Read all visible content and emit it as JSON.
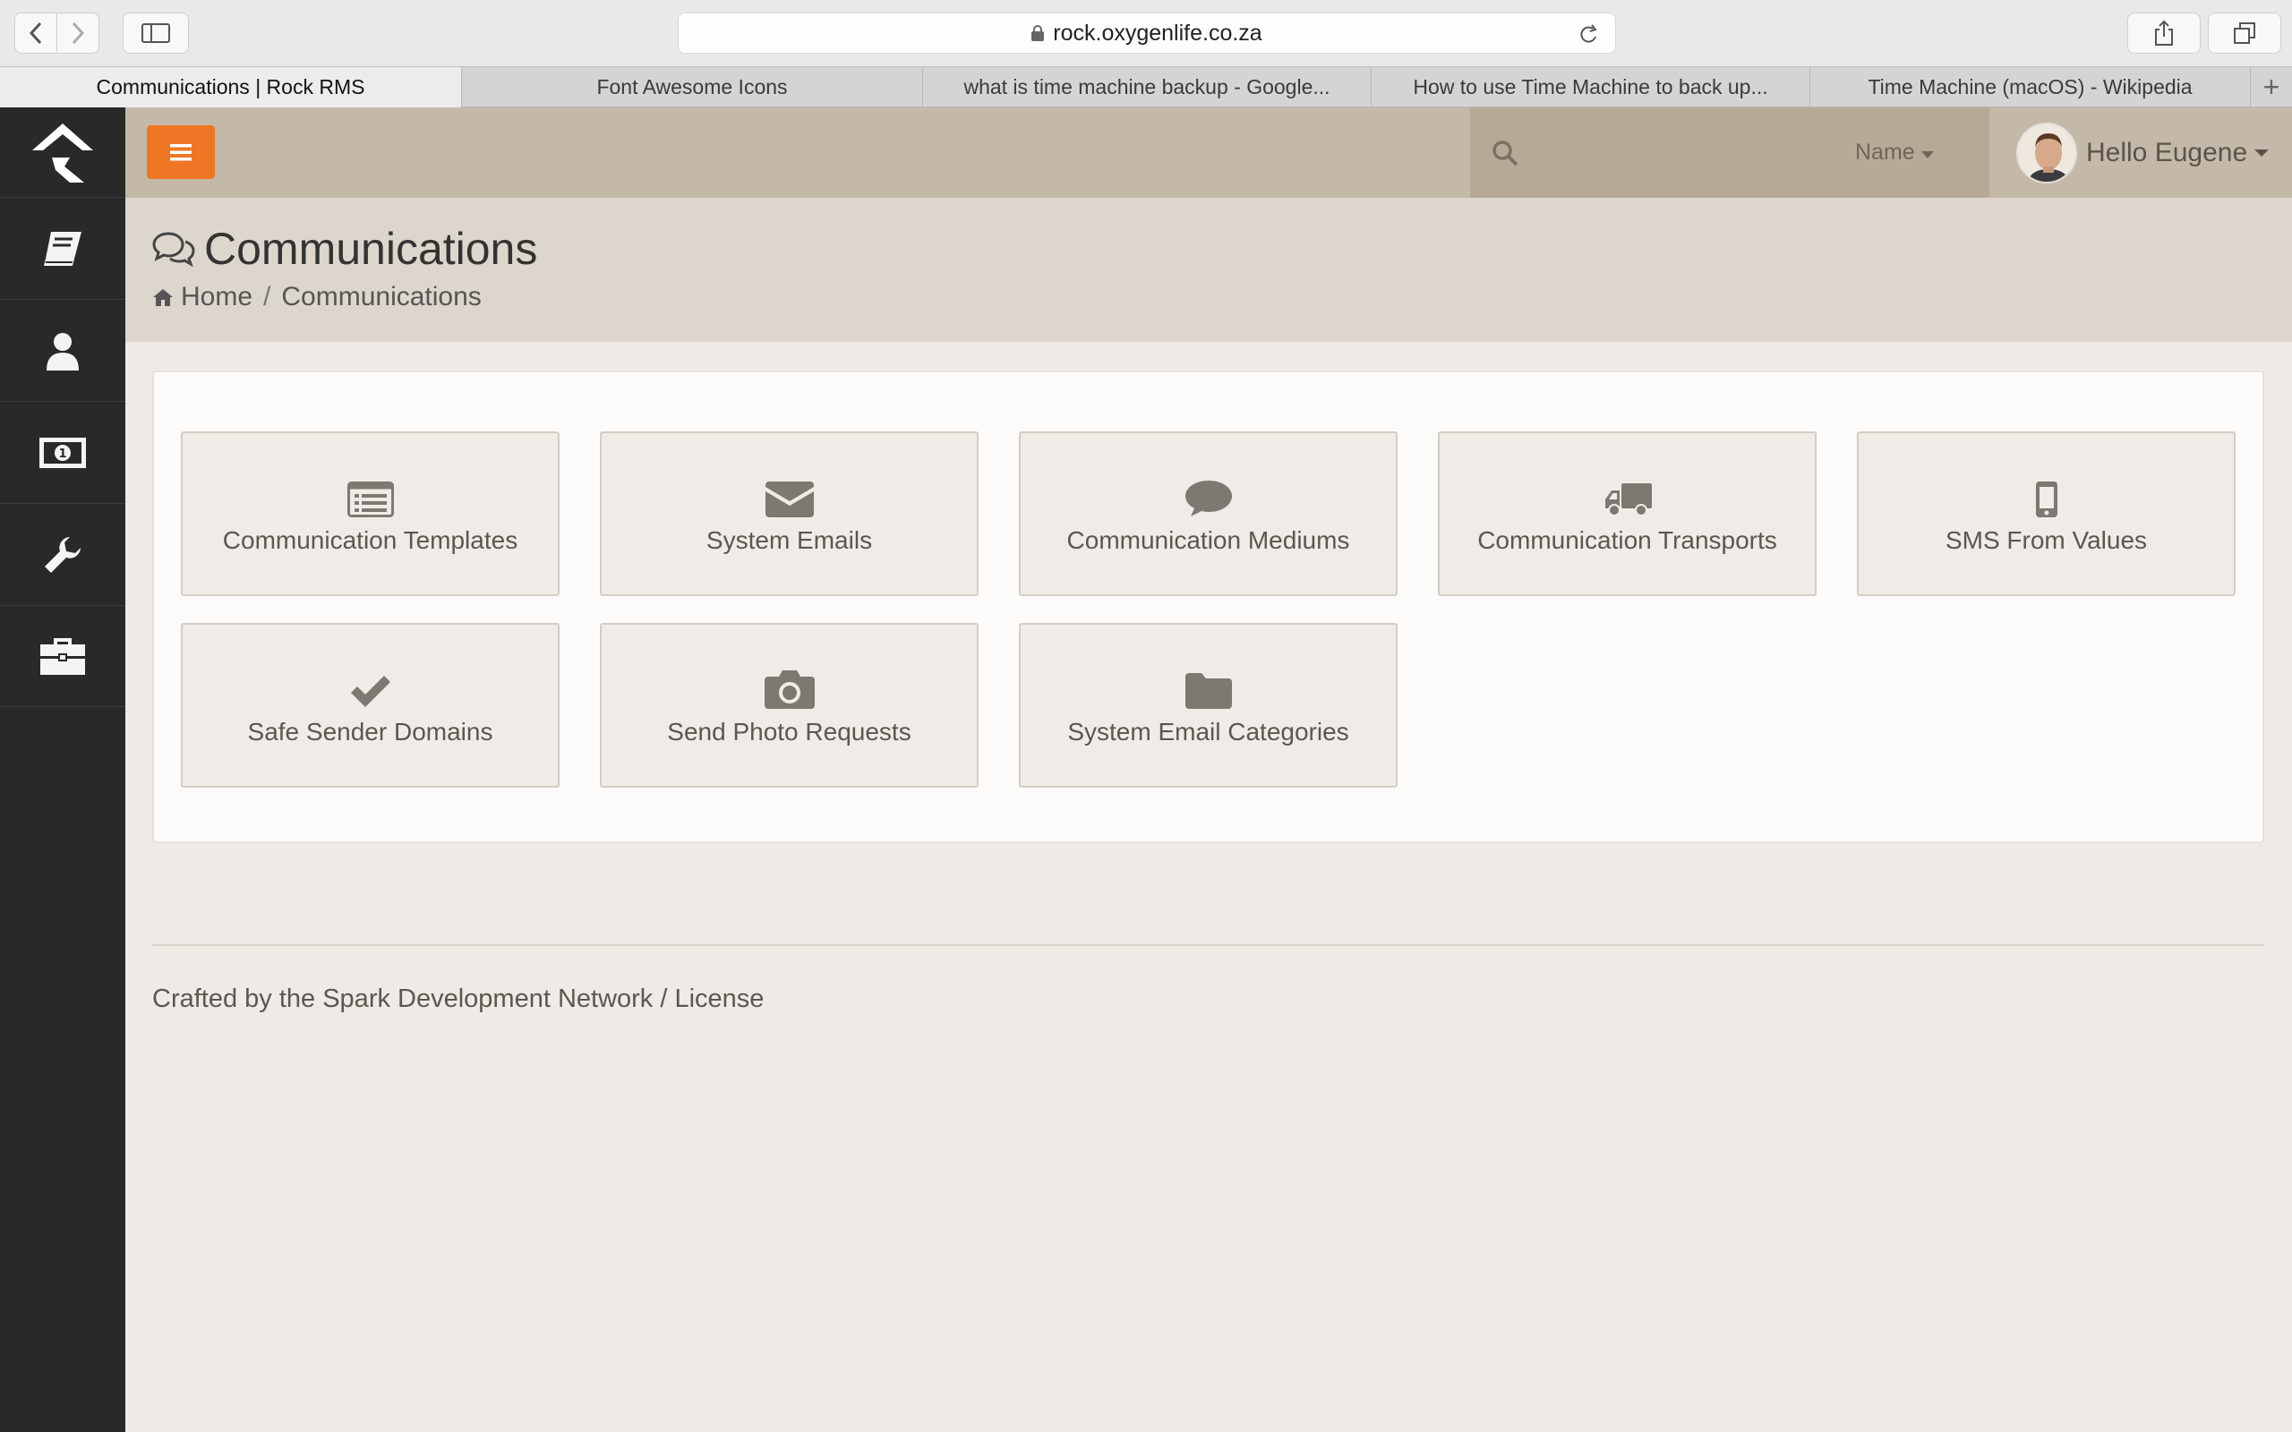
{
  "browser": {
    "url": "rock.oxygenlife.co.za",
    "tabs": [
      {
        "label": "Communications | Rock RMS",
        "active": true
      },
      {
        "label": "Font Awesome Icons",
        "active": false
      },
      {
        "label": "what is time machine backup - Google...",
        "active": false
      },
      {
        "label": "How to use Time Machine to back up...",
        "active": false
      },
      {
        "label": "Time Machine (macOS) - Wikipedia",
        "active": false
      }
    ],
    "new_tab_label": "+"
  },
  "header": {
    "search_placeholder": "",
    "search_filter_label": "Name",
    "user_greeting": "Hello Eugene",
    "accent_color": "#ee7625"
  },
  "sidebar": {
    "items": [
      {
        "icon": "book-icon"
      },
      {
        "icon": "user-icon"
      },
      {
        "icon": "money-icon"
      },
      {
        "icon": "wrench-icon"
      },
      {
        "icon": "briefcase-icon"
      }
    ]
  },
  "page": {
    "title": "Communications",
    "breadcrumb": [
      "Home",
      "Communications"
    ]
  },
  "tiles": [
    {
      "label": "Communication Templates",
      "icon": "list-alt-icon"
    },
    {
      "label": "System Emails",
      "icon": "envelope-icon"
    },
    {
      "label": "Communication Mediums",
      "icon": "comment-icon"
    },
    {
      "label": "Communication Transports",
      "icon": "truck-icon"
    },
    {
      "label": "SMS From Values",
      "icon": "mobile-icon"
    },
    {
      "label": "Safe Sender Domains",
      "icon": "check-icon"
    },
    {
      "label": "Send Photo Requests",
      "icon": "camera-icon"
    },
    {
      "label": "System Email Categories",
      "icon": "folder-icon"
    }
  ],
  "footer": {
    "text": "Crafted by the Spark Development Network / License"
  }
}
